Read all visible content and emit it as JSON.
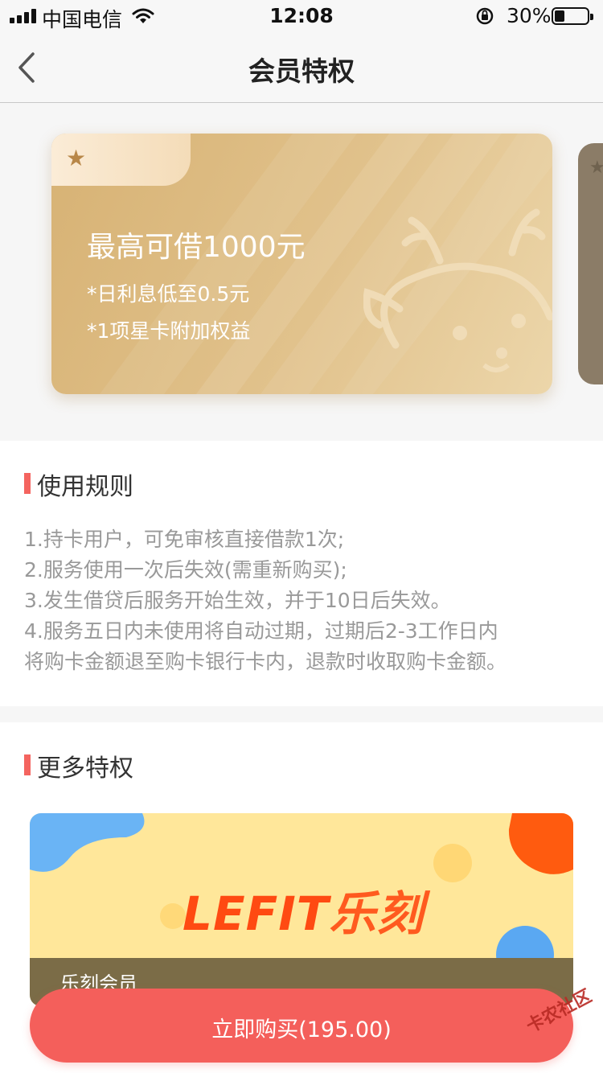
{
  "status_bar": {
    "carrier": "中国电信",
    "time": "12:08",
    "battery_percent": "30%",
    "battery_level": 0.3
  },
  "nav": {
    "title": "会员特权",
    "back_icon": "chevron-left-icon"
  },
  "member_card": {
    "star_icon": "star-icon",
    "title": "最高可借1000元",
    "line1": "*日利息低至0.5元",
    "line2": "*1项星卡附加权益",
    "decoration_icon": "deer-icon"
  },
  "rules": {
    "title": "使用规则",
    "items": [
      "1.持卡用户，可免审核直接借款1次;",
      "2.服务使用一次后失效(需重新购买);",
      "3.发生借贷后服务开始生效，并于10日后失效。",
      "4.服务五日内未使用将自动过期，过期后2-3工作日内",
      "将购卡金额退至购卡银行卡内，退款时收取购卡金额。"
    ]
  },
  "more": {
    "title": "更多特权",
    "promo": {
      "logo_text": "LEFIT",
      "logo_cn": "乐刻",
      "name": "乐刻会员"
    }
  },
  "buy_button": {
    "label": "立即购买(195.00)"
  },
  "watermark": "卡农社区",
  "colors": {
    "accent": "#f45f5b",
    "card_gold": "#dcb97d",
    "promo_yellow": "#ffe79a"
  }
}
